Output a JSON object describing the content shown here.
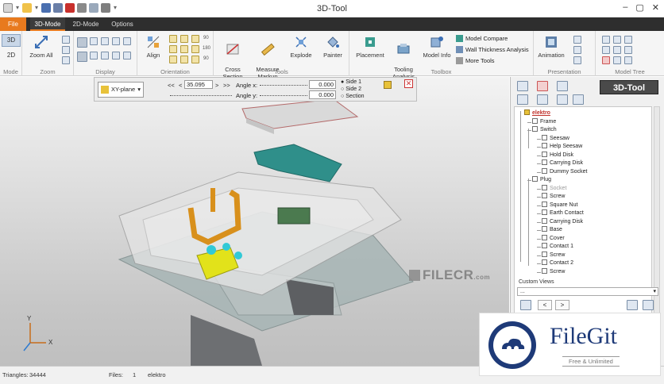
{
  "window": {
    "title": "3D-Tool",
    "controls": [
      "–",
      "▢",
      "✕"
    ]
  },
  "tabs": [
    {
      "label": "File"
    },
    {
      "label": "3D-Mode"
    },
    {
      "label": "2D-Mode"
    },
    {
      "label": "Options"
    }
  ],
  "ribbon": {
    "mode": {
      "caption": "Mode",
      "btn3d": "3D",
      "btn2d": "2D"
    },
    "zoom": {
      "caption": "Zoom",
      "zoom_all": "Zoom All"
    },
    "display": {
      "caption": "Display"
    },
    "orientation": {
      "caption": "Orientation",
      "align": "Align",
      "angle_labels": [
        "90",
        "180",
        "90"
      ]
    },
    "tools": {
      "caption": "Tools",
      "cross_section": "Cross\nSection",
      "measure": "Measure\nMarkup",
      "explode": "Explode",
      "painter": "Painter"
    },
    "toolbox": {
      "caption": "Toolbox",
      "placement": "Placement",
      "tooling": "Tooling\nAnalysis",
      "model_info": "Model Info",
      "model_compare": "Model Compare",
      "wall_thickness": "Wall Thickness Analysis",
      "more_tools": "More Tools"
    },
    "presentation": {
      "caption": "Presentation",
      "animation": "Animation"
    },
    "model_tree": {
      "caption": "Model Tree"
    }
  },
  "section_bar": {
    "plane": "XY-plane",
    "plane_badge": "XY",
    "nav_left": "<<",
    "nav_prev": "<",
    "value": "35.095",
    "nav_next": ">",
    "nav_right": ">>",
    "angle_x_label": "Angle x:",
    "angle_y_label": "Angle y:",
    "angle_x_value": "0.000",
    "angle_y_value": "0.000",
    "options": [
      "Side 1",
      "Side 2",
      "Section"
    ],
    "selected_option": "Side 1"
  },
  "viewport": {
    "watermark": "FILECR",
    "watermark_sub": ".com",
    "axis_x": "X",
    "axis_y": "Y"
  },
  "panel": {
    "logo": "3D-Tool",
    "tree": [
      {
        "label": "elektro",
        "level": 0,
        "root": true
      },
      {
        "label": "Frame",
        "level": 1
      },
      {
        "label": "Switch",
        "level": 1,
        "expanded": true
      },
      {
        "label": "Seesaw",
        "level": 2
      },
      {
        "label": "Help Seesaw",
        "level": 2
      },
      {
        "label": "Hold Disk",
        "level": 2
      },
      {
        "label": "Carrying Disk",
        "level": 2
      },
      {
        "label": "Dummy Socket",
        "level": 2
      },
      {
        "label": "Plug",
        "level": 1,
        "expanded": true
      },
      {
        "label": "Socket",
        "level": 2,
        "dim": true
      },
      {
        "label": "Screw",
        "level": 2
      },
      {
        "label": "Square Nut",
        "level": 2
      },
      {
        "label": "Earth Contact",
        "level": 2
      },
      {
        "label": "Carrying Disk",
        "level": 2
      },
      {
        "label": "Base",
        "level": 2
      },
      {
        "label": "Cover",
        "level": 2
      },
      {
        "label": "Contact 1",
        "level": 2
      },
      {
        "label": "Screw",
        "level": 2
      },
      {
        "label": "Contact 2",
        "level": 2
      },
      {
        "label": "Screw",
        "level": 2
      }
    ],
    "custom_views_label": "Custom Views",
    "custom_views_value": "...",
    "nav_prev": "<",
    "nav_next": ">"
  },
  "status": {
    "triangles_label": "Triangles:",
    "triangles_value": "34444",
    "files_label": "Files:",
    "files_value": "1",
    "file_name": "elektro"
  },
  "filegit": {
    "brand": "FileGit",
    "tagline": "Free & Unlimited"
  },
  "colors": {
    "accent": "#e87a1e",
    "tab_bg": "#2e2e2e",
    "part_teal": "#2f8f8a",
    "part_orange": "#d8901c",
    "part_yellow": "#e2e21a",
    "part_cyan": "#31c9d6",
    "part_green": "#4b7a4f"
  }
}
